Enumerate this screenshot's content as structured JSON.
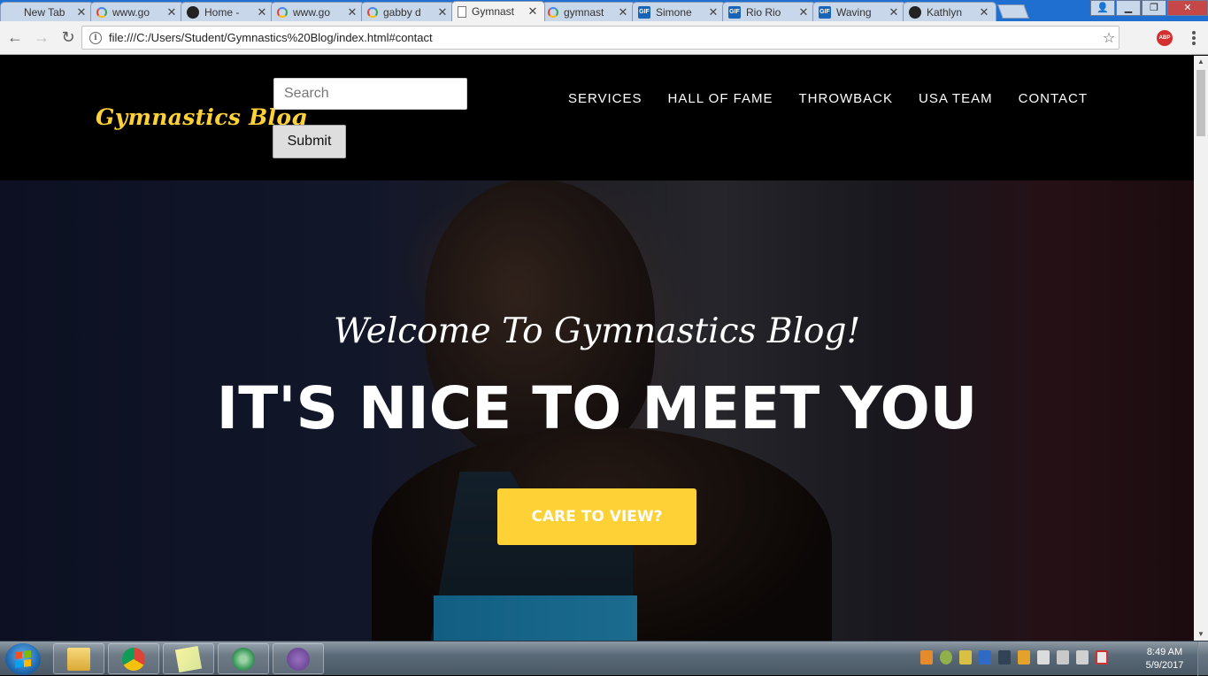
{
  "browser": {
    "tabs": [
      {
        "label": "New Tab",
        "icon": "blank-icon",
        "active": false
      },
      {
        "label": "www.go",
        "icon": "google-icon",
        "active": false
      },
      {
        "label": "Home - ",
        "icon": "github-icon",
        "active": false
      },
      {
        "label": "www.go",
        "icon": "google-icon",
        "active": false
      },
      {
        "label": "gabby d",
        "icon": "google-icon",
        "active": false
      },
      {
        "label": "Gymnast",
        "icon": "document-icon",
        "active": true
      },
      {
        "label": "gymnast",
        "icon": "google-icon",
        "active": false
      },
      {
        "label": "Simone",
        "icon": "gif-icon",
        "active": false
      },
      {
        "label": "Rio Rio",
        "icon": "gif-icon",
        "active": false
      },
      {
        "label": "Waving",
        "icon": "gif-icon",
        "active": false
      },
      {
        "label": "Kathlyn",
        "icon": "github-icon",
        "active": false
      }
    ],
    "gif_badge": "GIF",
    "address": "file:///C:/Users/Student/Gymnastics%20Blog/index.html#contact",
    "extension_badge": "ABP"
  },
  "page": {
    "brand": "Gymnastics Blog",
    "search": {
      "placeholder": "Search",
      "value": ""
    },
    "submit_label": "Submit",
    "nav": [
      "SERVICES",
      "HALL OF FAME",
      "THROWBACK",
      "USA TEAM",
      "CONTACT"
    ],
    "welcome": "Welcome To Gymnastics Blog!",
    "headline": "IT'S NICE TO MEET YOU",
    "cta_label": "CARE TO VIEW?",
    "colors": {
      "accent": "#fed136",
      "header_bg": "#000000",
      "hero_text": "#ffffff"
    }
  },
  "taskbar": {
    "apps": [
      "file-explorer-icon",
      "chrome-icon",
      "sticky-notes-icon",
      "atom-icon",
      "github-desktop-icon"
    ],
    "time": "8:49 AM",
    "date": "5/9/2017"
  }
}
